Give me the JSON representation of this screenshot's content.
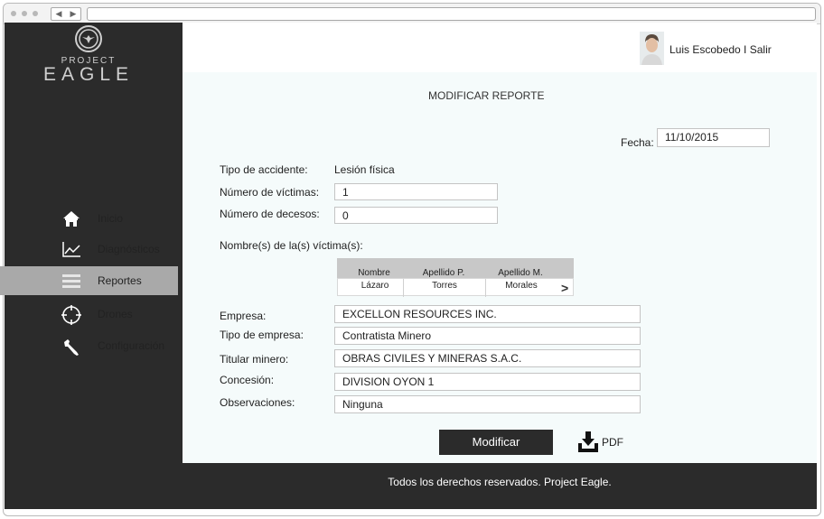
{
  "app": {
    "logo_small": "PROJECT",
    "logo_big": "EAGLE"
  },
  "user": {
    "name_label": "Luis Escobedo I Salir"
  },
  "sidebar": {
    "items": [
      {
        "label": "Inicio",
        "icon": "home-icon",
        "active": false
      },
      {
        "label": "Diagnósticos",
        "icon": "chart-line-icon",
        "active": false
      },
      {
        "label": "Reportes",
        "icon": "menu-lines-icon",
        "active": true
      },
      {
        "label": "Drones",
        "icon": "crosshair-icon",
        "active": false
      },
      {
        "label": "Configuración",
        "icon": "wrench-icon",
        "active": false
      }
    ]
  },
  "page": {
    "title": "MODIFICAR REPORTE"
  },
  "form": {
    "fecha_label": "Fecha:",
    "fecha_value": "11/10/2015",
    "tipo_accidente_label": "Tipo de accidente:",
    "tipo_accidente_value": "Lesión física",
    "num_victimas_label": "Número de víctimas:",
    "num_victimas_value": "1",
    "num_decesos_label": "Número de decesos:",
    "num_decesos_value": "0",
    "nombres_label": "Nombre(s) de la(s) víctima(s):",
    "empresa_label": "Empresa:",
    "empresa_value": "EXCELLON RESOURCES INC.",
    "tipo_empresa_label": "Tipo de empresa:",
    "tipo_empresa_value": "Contratista Minero",
    "titular_label": "Titular minero:",
    "titular_value": "OBRAS CIVILES Y MINERAS S.A.C.",
    "concesion_label": "Concesión:",
    "concesion_value": "DIVISION OYON 1",
    "observaciones_label": "Observaciones:",
    "observaciones_value": "Ninguna"
  },
  "victims_table": {
    "headers": [
      "Nombre",
      "Apellido P.",
      "Apellido M."
    ],
    "rows": [
      [
        "Lázaro",
        "Torres",
        "Morales"
      ]
    ],
    "next_glyph": ">"
  },
  "actions": {
    "submit_label": "Modificar",
    "pdf_label": "PDF"
  },
  "footer": {
    "text": "Todos los derechos reservados. Project Eagle."
  }
}
